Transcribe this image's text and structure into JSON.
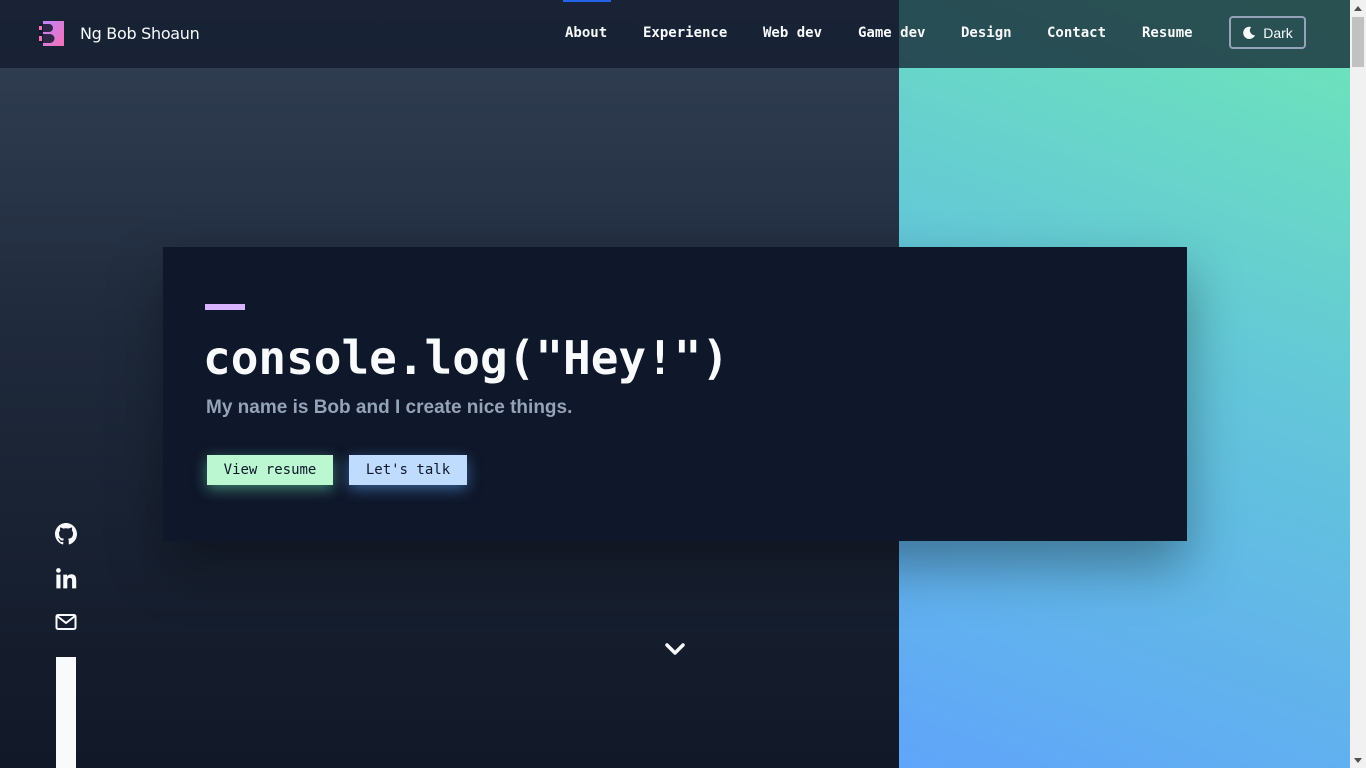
{
  "brand": {
    "name": "Ng Bob Shoaun",
    "logo_icon": "brand-logo-icon"
  },
  "nav": {
    "items": [
      {
        "label": "About",
        "active": true
      },
      {
        "label": "Experience"
      },
      {
        "label": "Web dev"
      },
      {
        "label": "Game dev"
      },
      {
        "label": "Design"
      },
      {
        "label": "Contact"
      },
      {
        "label": "Resume"
      }
    ],
    "theme_toggle": {
      "label": "Dark",
      "icon": "moon-icon"
    }
  },
  "hero": {
    "title": "console.log(\"Hey!\")",
    "subtitle": "My name is Bob and I create nice things.",
    "buttons": {
      "resume": "View resume",
      "talk": "Let's talk"
    }
  },
  "social": {
    "icons": [
      "github-icon",
      "linkedin-icon",
      "mail-icon"
    ]
  },
  "colors": {
    "accent_purple": "#d8b4fe",
    "button_green": "#bbf7d0",
    "button_blue": "#bfdbfe",
    "nav_active": "#2563eb",
    "gradient_top": "#6ee7b7",
    "gradient_bottom": "#60a5fa"
  }
}
